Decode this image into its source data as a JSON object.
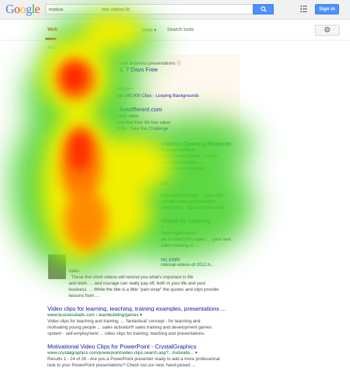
{
  "header": {
    "logo_letters": [
      {
        "ch": "G",
        "color": "#4285f4"
      },
      {
        "ch": "o",
        "color": "#ea4335"
      },
      {
        "ch": "o",
        "color": "#fbbc05"
      },
      {
        "ch": "g",
        "color": "#4285f4"
      },
      {
        "ch": "l",
        "color": "#34a853"
      },
      {
        "ch": "e",
        "color": "#ea4335"
      }
    ],
    "search_text": "motiva",
    "search_text_tail": "nes videos fo",
    "signin_label": "Sign in"
  },
  "tabs": {
    "web": "Web",
    "more": "More ▾",
    "search_tools": "Search tools"
  },
  "stats": "Abo",
  "ads": {
    "header": "s for business presentations",
    "ad1_title": "s. 7 Days Free",
    "ad1_line1": "noogle+",
    "ad1_line2": "ver 100,000 Clips - Looping Backgrounds",
    "ad2_title": "livedifferent.com",
    "ad2_line1": ") 432 4484",
    "ad2_line2": "one that their life has value",
    "ad2_line3": "d Us - Take the Challenge"
  },
  "results": [
    {
      "title": "Videos | Opening Moments",
      "url": "business%20pres...",
      "snippets": [
        "utive Director David ... of the",
        "and organizations! ...",
        "- The Human Element ..."
      ]
    },
    {
      "title": "dia",
      "url": "",
      "snippets": [
        "ents and meetings. ... your next",
        "rporate event unforgettable! ...",
        "Video Clips - Opening Moments"
      ]
    },
    {
      "title": "Videos by Opening",
      "url": "o",
      "snippets": [
        "OpeningMoments",
        "yer to watch this video. ... your next",
        "sales meeting or ..."
      ]
    },
    {
      "title": "nc.com",
      "url": "rational-videos-of-2012.h...",
      "snippets": [
        "video",
        ". These five short videos will remind you what's important in life",
        "and work. ... and courage can really pay off, both in your life and your",
        "business. ... While the title is a little \"pain wrap\" the quotes and clips provide",
        "lessons from ..."
      ]
    },
    {
      "title": "Video clips for learning, teaching, training examples, presentations ...",
      "url": "www.businessballs.com › teambuilding/games ▾",
      "snippets": [
        "Video clips for teaching and training. ... 'fantastical' concept - for teaching and",
        "motivating young people ... sales activator® sales training and development games",
        "system · self-employment ... video clips for training, teaching and presentations."
      ]
    },
    {
      "title": "Motivational Video Clips for PowerPoint - CrystalGraphics",
      "url": "www.crystalgraphics.com/powerpoint/video.clips.search.asp?...motivatio... ▾",
      "snippets": [
        "Results 1 - 24 of 26 - Are you a PowerPoint presenter ready to add a more professional",
        "look to your PowerPoint presentations? Check out our new, hand-picked ..."
      ]
    }
  ]
}
